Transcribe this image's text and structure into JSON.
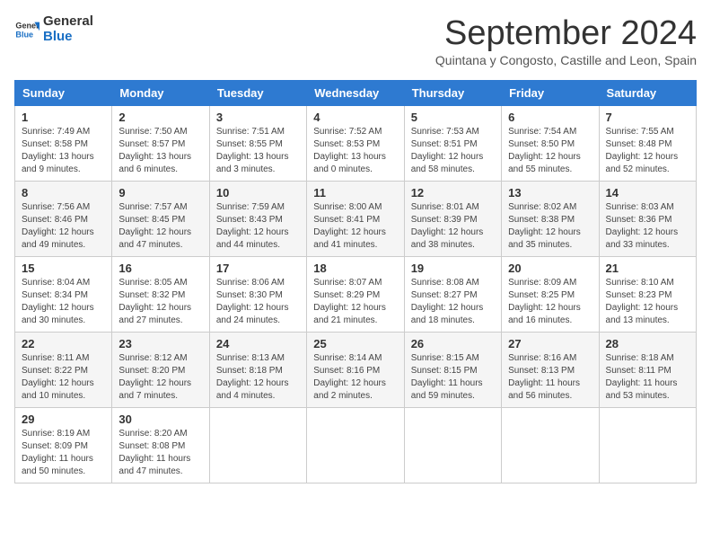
{
  "logo": {
    "line1": "General",
    "line2": "Blue"
  },
  "title": "September 2024",
  "subtitle": "Quintana y Congosto, Castille and Leon, Spain",
  "weekdays": [
    "Sunday",
    "Monday",
    "Tuesday",
    "Wednesday",
    "Thursday",
    "Friday",
    "Saturday"
  ],
  "weeks": [
    [
      {
        "day": "1",
        "sunrise": "7:49 AM",
        "sunset": "8:58 PM",
        "daylight": "13 hours and 9 minutes."
      },
      {
        "day": "2",
        "sunrise": "7:50 AM",
        "sunset": "8:57 PM",
        "daylight": "13 hours and 6 minutes."
      },
      {
        "day": "3",
        "sunrise": "7:51 AM",
        "sunset": "8:55 PM",
        "daylight": "13 hours and 3 minutes."
      },
      {
        "day": "4",
        "sunrise": "7:52 AM",
        "sunset": "8:53 PM",
        "daylight": "13 hours and 0 minutes."
      },
      {
        "day": "5",
        "sunrise": "7:53 AM",
        "sunset": "8:51 PM",
        "daylight": "12 hours and 58 minutes."
      },
      {
        "day": "6",
        "sunrise": "7:54 AM",
        "sunset": "8:50 PM",
        "daylight": "12 hours and 55 minutes."
      },
      {
        "day": "7",
        "sunrise": "7:55 AM",
        "sunset": "8:48 PM",
        "daylight": "12 hours and 52 minutes."
      }
    ],
    [
      {
        "day": "8",
        "sunrise": "7:56 AM",
        "sunset": "8:46 PM",
        "daylight": "12 hours and 49 minutes."
      },
      {
        "day": "9",
        "sunrise": "7:57 AM",
        "sunset": "8:45 PM",
        "daylight": "12 hours and 47 minutes."
      },
      {
        "day": "10",
        "sunrise": "7:59 AM",
        "sunset": "8:43 PM",
        "daylight": "12 hours and 44 minutes."
      },
      {
        "day": "11",
        "sunrise": "8:00 AM",
        "sunset": "8:41 PM",
        "daylight": "12 hours and 41 minutes."
      },
      {
        "day": "12",
        "sunrise": "8:01 AM",
        "sunset": "8:39 PM",
        "daylight": "12 hours and 38 minutes."
      },
      {
        "day": "13",
        "sunrise": "8:02 AM",
        "sunset": "8:38 PM",
        "daylight": "12 hours and 35 minutes."
      },
      {
        "day": "14",
        "sunrise": "8:03 AM",
        "sunset": "8:36 PM",
        "daylight": "12 hours and 33 minutes."
      }
    ],
    [
      {
        "day": "15",
        "sunrise": "8:04 AM",
        "sunset": "8:34 PM",
        "daylight": "12 hours and 30 minutes."
      },
      {
        "day": "16",
        "sunrise": "8:05 AM",
        "sunset": "8:32 PM",
        "daylight": "12 hours and 27 minutes."
      },
      {
        "day": "17",
        "sunrise": "8:06 AM",
        "sunset": "8:30 PM",
        "daylight": "12 hours and 24 minutes."
      },
      {
        "day": "18",
        "sunrise": "8:07 AM",
        "sunset": "8:29 PM",
        "daylight": "12 hours and 21 minutes."
      },
      {
        "day": "19",
        "sunrise": "8:08 AM",
        "sunset": "8:27 PM",
        "daylight": "12 hours and 18 minutes."
      },
      {
        "day": "20",
        "sunrise": "8:09 AM",
        "sunset": "8:25 PM",
        "daylight": "12 hours and 16 minutes."
      },
      {
        "day": "21",
        "sunrise": "8:10 AM",
        "sunset": "8:23 PM",
        "daylight": "12 hours and 13 minutes."
      }
    ],
    [
      {
        "day": "22",
        "sunrise": "8:11 AM",
        "sunset": "8:22 PM",
        "daylight": "12 hours and 10 minutes."
      },
      {
        "day": "23",
        "sunrise": "8:12 AM",
        "sunset": "8:20 PM",
        "daylight": "12 hours and 7 minutes."
      },
      {
        "day": "24",
        "sunrise": "8:13 AM",
        "sunset": "8:18 PM",
        "daylight": "12 hours and 4 minutes."
      },
      {
        "day": "25",
        "sunrise": "8:14 AM",
        "sunset": "8:16 PM",
        "daylight": "12 hours and 2 minutes."
      },
      {
        "day": "26",
        "sunrise": "8:15 AM",
        "sunset": "8:15 PM",
        "daylight": "11 hours and 59 minutes."
      },
      {
        "day": "27",
        "sunrise": "8:16 AM",
        "sunset": "8:13 PM",
        "daylight": "11 hours and 56 minutes."
      },
      {
        "day": "28",
        "sunrise": "8:18 AM",
        "sunset": "8:11 PM",
        "daylight": "11 hours and 53 minutes."
      }
    ],
    [
      {
        "day": "29",
        "sunrise": "8:19 AM",
        "sunset": "8:09 PM",
        "daylight": "11 hours and 50 minutes."
      },
      {
        "day": "30",
        "sunrise": "8:20 AM",
        "sunset": "8:08 PM",
        "daylight": "11 hours and 47 minutes."
      },
      null,
      null,
      null,
      null,
      null
    ]
  ],
  "labels": {
    "sunrise": "Sunrise:",
    "sunset": "Sunset:",
    "daylight": "Daylight:"
  }
}
